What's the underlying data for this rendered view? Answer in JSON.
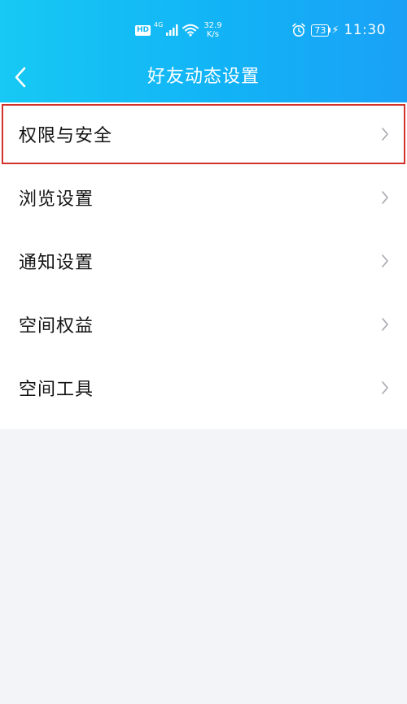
{
  "status_bar": {
    "hd": "HD",
    "network": "4G",
    "speed_value": "32.9",
    "speed_unit": "K/s",
    "battery": "73",
    "time": "11:30"
  },
  "header": {
    "title": "好友动态设置",
    "background": "#17c9f4"
  },
  "menu": {
    "items": [
      {
        "label": "权限与安全"
      },
      {
        "label": "浏览设置"
      },
      {
        "label": "通知设置"
      },
      {
        "label": "空间权益"
      },
      {
        "label": "空间工具"
      }
    ]
  },
  "colors": {
    "highlight_border": "#d2322b",
    "page_background": "#f3f4f8",
    "chevron": "#a6a8ad"
  }
}
